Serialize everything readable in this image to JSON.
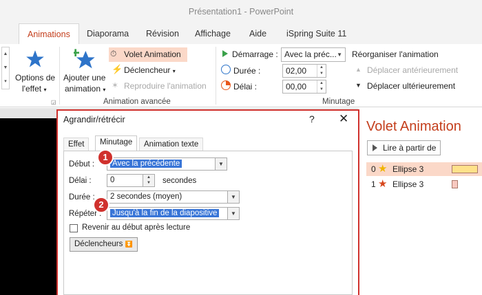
{
  "window": {
    "title": "Présentation1  -  PowerPoint"
  },
  "tabs": [
    {
      "label": "Animations"
    },
    {
      "label": "Diaporama"
    },
    {
      "label": "Révision"
    },
    {
      "label": "Affichage"
    },
    {
      "label": "Aide"
    },
    {
      "label": "iSpring Suite 11"
    }
  ],
  "ribbon": {
    "effect_options_l1": "Options de",
    "effect_options_l2": "l'effet",
    "add_anim_l1": "Ajouter une",
    "add_anim_l2": "animation",
    "anim_pane": "Volet Animation",
    "trigger": "Déclencheur",
    "repro": "Reproduire l'animation",
    "group_advanced": "Animation avancée",
    "start_label": "Démarrage :",
    "start_value": "Avec la préc...",
    "duration_label": "Durée :",
    "duration_value": "02,00",
    "delay_label": "Délai :",
    "delay_value": "00,00",
    "reorder": "Réorganiser l'animation",
    "move_earlier": "Déplacer antérieurement",
    "move_later": "Déplacer ultérieurement",
    "group_timing": "Minutage"
  },
  "pane": {
    "title": "Volet Animation",
    "play_button": "Lire à partir de",
    "items": [
      {
        "num": "0",
        "name": "Ellipse 3",
        "star_color": "#f0b400",
        "bar_color": "#ffe18a"
      },
      {
        "num": "1",
        "name": "Ellipse 3",
        "star_color": "#d6461c",
        "bar_color": "#f8c9c0"
      }
    ]
  },
  "dialog": {
    "title": "Agrandir/rétrécir",
    "help": "?",
    "tabs": {
      "effect": "Effet",
      "timing": "Minutage",
      "text_anim": "Animation texte"
    },
    "start_label": "Début :",
    "start_value": "Avec la précédente",
    "delay_label": "Délai :",
    "delay_value": "0",
    "delay_unit": "secondes",
    "duration_label": "Durée :",
    "duration_value": "2 secondes (moyen)",
    "repeat_label": "Répéter :",
    "repeat_value": "Jusqu'à la fin de la diapositive",
    "rewind_label": "Revenir au début après lecture",
    "triggers_button": "Déclencheurs"
  },
  "badges": [
    "1",
    "2"
  ],
  "colors": {
    "accent": "#c43e1c",
    "badge": "#d0312d",
    "selection": "#3875d7",
    "star_blue": "#2e74c9"
  }
}
